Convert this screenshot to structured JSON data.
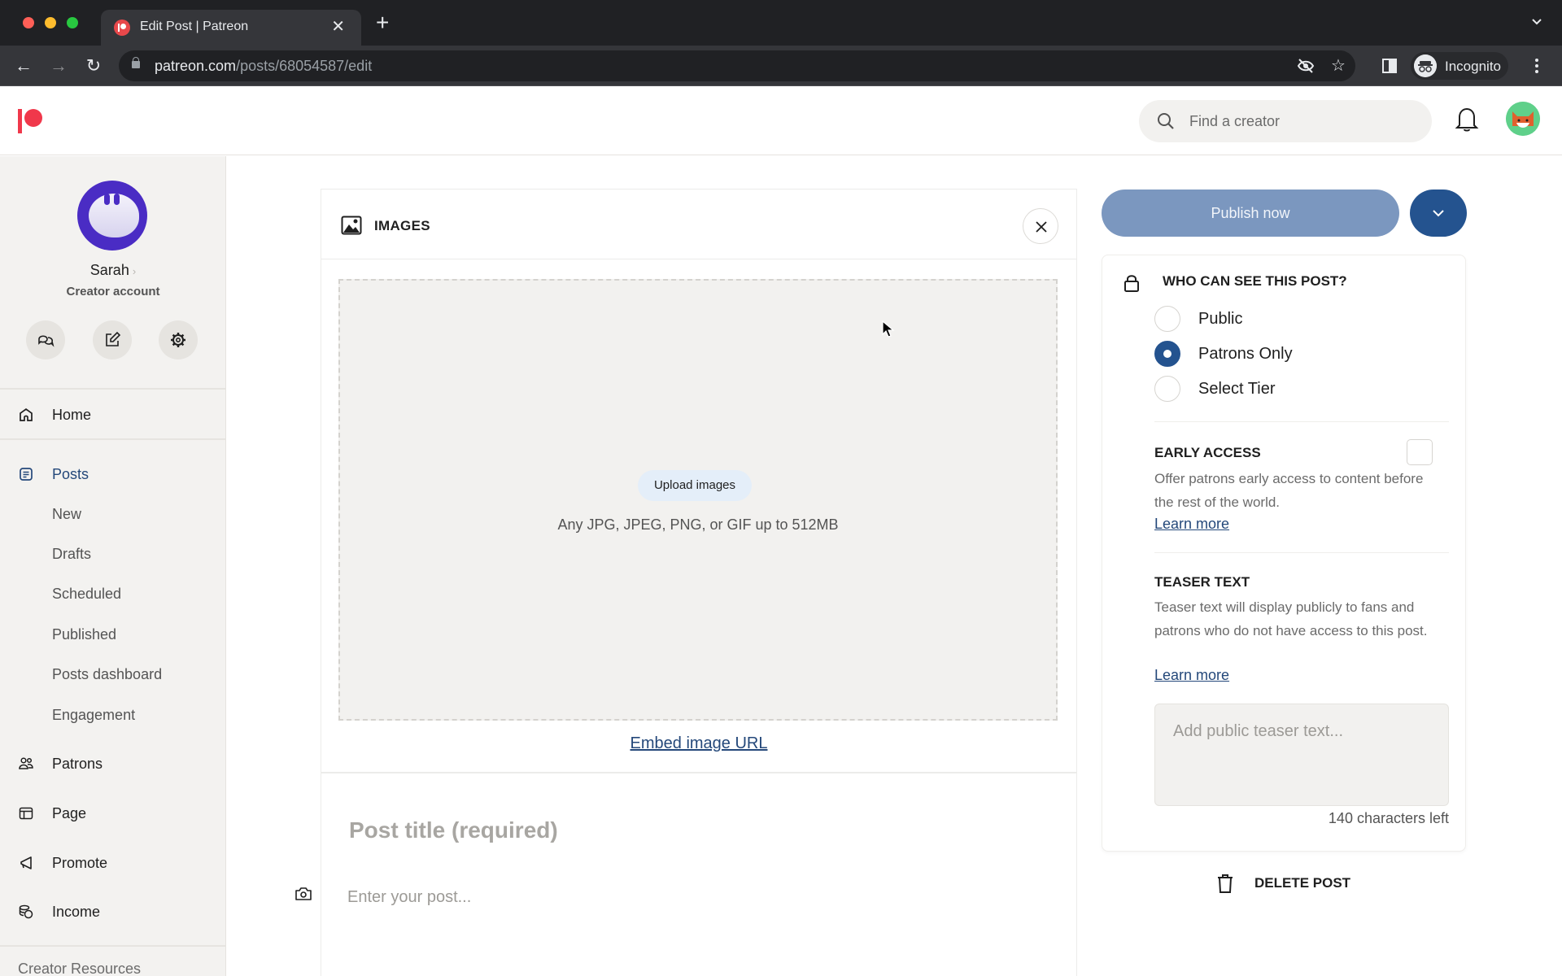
{
  "browser": {
    "tab_title": "Edit Post | Patreon",
    "url_host": "patreon.com",
    "url_path": "/posts/68054587/edit",
    "profile_label": "Incognito"
  },
  "header": {
    "search_placeholder": "Find a creator",
    "brand_color": "#f0384b"
  },
  "sidebar": {
    "profile": {
      "name": "Sarah",
      "role": "Creator account"
    },
    "quick_actions": [
      {
        "icon": "chat-bubbles-icon",
        "label": "Messages"
      },
      {
        "icon": "edit-icon",
        "label": "Create post"
      },
      {
        "icon": "gear-icon",
        "label": "Settings"
      }
    ],
    "nav": {
      "home": "Home",
      "posts": "Posts",
      "posts_sub": [
        "New",
        "Drafts",
        "Scheduled",
        "Published",
        "Posts dashboard",
        "Engagement"
      ],
      "patrons": "Patrons",
      "page": "Page",
      "promote": "Promote",
      "income": "Income"
    },
    "footer_link": "Creator Resources",
    "active_item": "Posts"
  },
  "editor": {
    "section_title": "IMAGES",
    "upload_button": "Upload images",
    "upload_hint": "Any JPG, JPEG, PNG, or GIF up to 512MB",
    "embed_link": "Embed image URL",
    "title_placeholder": "Post title (required)",
    "title_value": "",
    "body_placeholder": "Enter your post...",
    "body_value": ""
  },
  "publish": {
    "button_label": "Publish now",
    "button_color": "#7b97bf",
    "menu_color": "#24538f"
  },
  "visibility": {
    "title": "WHO CAN SEE THIS POST?",
    "options": [
      "Public",
      "Patrons Only",
      "Select Tier"
    ],
    "selected": "Patrons Only"
  },
  "early_access": {
    "title": "EARLY ACCESS",
    "description": "Offer patrons early access to content before the rest of the world.",
    "learn_more": "Learn more",
    "checked": false
  },
  "teaser": {
    "title": "TEASER TEXT",
    "description": "Teaser text will display publicly to fans and patrons who do not have access to this post.",
    "learn_more": "Learn more",
    "placeholder": "Add public teaser text...",
    "value": "",
    "chars_left": "140 characters left"
  },
  "delete": {
    "label": "DELETE POST"
  }
}
